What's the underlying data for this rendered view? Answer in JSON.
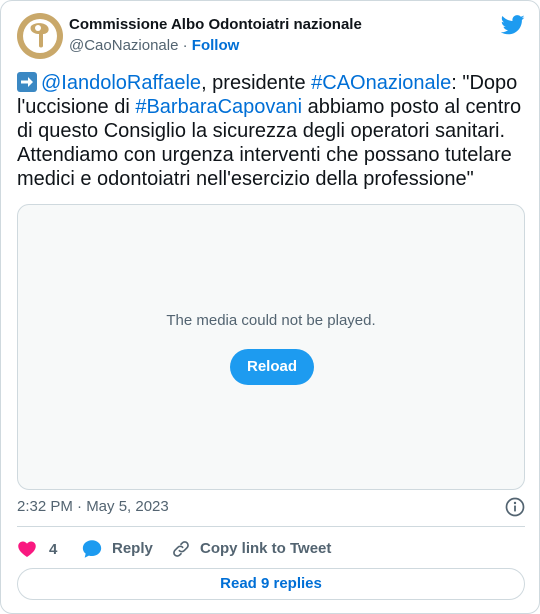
{
  "author": {
    "display_name": "Commissione Albo Odontoiatri nazionale",
    "handle": "@CaoNazionale",
    "separator": "·",
    "follow_label": "Follow",
    "avatar_color": "#c9a86a"
  },
  "tweet": {
    "emoji_icon": "right-arrow-emoji-icon",
    "mention": "@IandoloRaffaele",
    "text_1": ", presidente ",
    "hashtag_1": "#CAOnazionale",
    "text_2": ": \"Dopo l'uccisione di ",
    "hashtag_2": "#BarbaraCapovani",
    "text_3": " abbiamo posto al centro di questo Consiglio la sicurezza degli operatori sanitari. Attendiamo con urgenza interventi che possano tutelare medici e odontoiatri nell'esercizio della professione\""
  },
  "media": {
    "message": "The media could not be played.",
    "reload_label": "Reload"
  },
  "meta": {
    "timestamp": "2:32 PM · May 5, 2023"
  },
  "actions": {
    "like_count": "4",
    "reply_label": "Reply",
    "copy_label": "Copy link to Tweet"
  },
  "footer": {
    "read_replies_label": "Read 9 replies"
  },
  "colors": {
    "brand_blue": "#1d9bf0",
    "link_blue": "#006fd6",
    "heart_pink": "#f91880",
    "muted_text": "#536471",
    "border": "#cfd9de"
  }
}
